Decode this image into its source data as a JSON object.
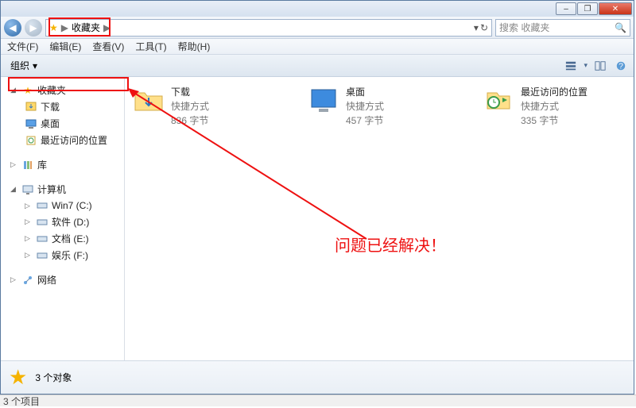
{
  "window_controls": {
    "min": "–",
    "max": "❐",
    "close": "✕"
  },
  "nav": {
    "back_glyph": "◀",
    "fwd_glyph": "▶",
    "path_root": "收藏夹",
    "sep": "▶",
    "dropdown_glyph": "▾",
    "refresh_glyph": "↻"
  },
  "search": {
    "placeholder": "搜索 收藏夹",
    "mag": "🔍"
  },
  "menubar": [
    "文件(F)",
    "编辑(E)",
    "查看(V)",
    "工具(T)",
    "帮助(H)"
  ],
  "toolbar": {
    "organize": "组织",
    "organize_drop": "▾"
  },
  "tree": {
    "favorites": {
      "label": "收藏夹",
      "children": [
        "下载",
        "桌面",
        "最近访问的位置"
      ]
    },
    "libraries": {
      "label": "库"
    },
    "computer": {
      "label": "计算机",
      "children": [
        "Win7 (C:)",
        "软件 (D:)",
        "文档 (E:)",
        "娱乐 (F:)"
      ]
    },
    "network": {
      "label": "网络"
    },
    "exp_open": "◢",
    "exp_closed": "▷"
  },
  "items": [
    {
      "title": "下载",
      "line1": "快捷方式",
      "line2": "836 字节"
    },
    {
      "title": "桌面",
      "line1": "快捷方式",
      "line2": "457 字节"
    },
    {
      "title": "最近访问的位置",
      "line1": "快捷方式",
      "line2": "335 字节"
    }
  ],
  "status": {
    "count_text": "3 个对象"
  },
  "footer": {
    "text": "3 个项目"
  },
  "annotation": {
    "text": "问题已经解决！"
  }
}
